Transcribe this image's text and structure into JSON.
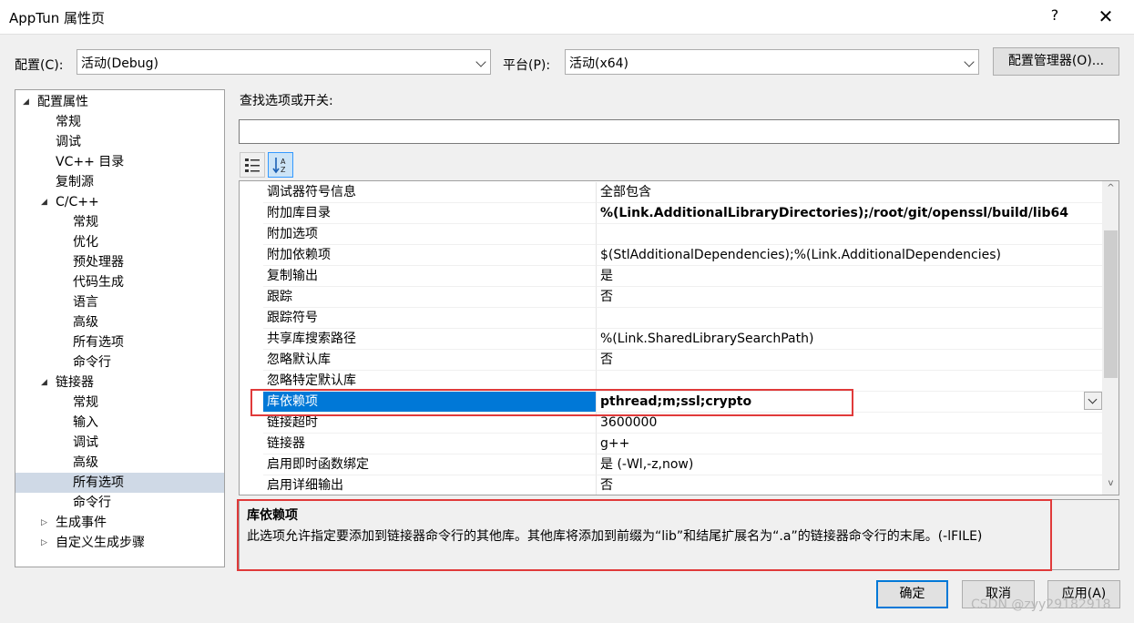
{
  "window": {
    "title": "AppTun 属性页",
    "help_glyph": "?",
    "close_glyph": "✕"
  },
  "config": {
    "label": "配置(C):",
    "value": "活动(Debug)",
    "platform_label": "平台(P):",
    "platform_value": "活动(x64)",
    "manager_button": "配置管理器(O)..."
  },
  "tree": {
    "items": [
      {
        "label": "配置属性",
        "level": 0,
        "expander": "◢"
      },
      {
        "label": "常规",
        "level": 2
      },
      {
        "label": "调试",
        "level": 2
      },
      {
        "label": "VC++ 目录",
        "level": 2
      },
      {
        "label": "复制源",
        "level": 2
      },
      {
        "label": "C/C++",
        "level": 1,
        "expander": "◢"
      },
      {
        "label": "常规",
        "level": 3
      },
      {
        "label": "优化",
        "level": 3
      },
      {
        "label": "预处理器",
        "level": 3
      },
      {
        "label": "代码生成",
        "level": 3
      },
      {
        "label": "语言",
        "level": 3
      },
      {
        "label": "高级",
        "level": 3
      },
      {
        "label": "所有选项",
        "level": 3
      },
      {
        "label": "命令行",
        "level": 3
      },
      {
        "label": "链接器",
        "level": 1,
        "expander": "◢"
      },
      {
        "label": "常规",
        "level": 3
      },
      {
        "label": "输入",
        "level": 3
      },
      {
        "label": "调试",
        "level": 3
      },
      {
        "label": "高级",
        "level": 3
      },
      {
        "label": "所有选项",
        "level": 3,
        "selected": true
      },
      {
        "label": "命令行",
        "level": 3
      },
      {
        "label": "生成事件",
        "level": 1,
        "expander": "▷"
      },
      {
        "label": "自定义生成步骤",
        "level": 1,
        "expander": "▷"
      }
    ]
  },
  "search": {
    "label": "查找选项或开关:",
    "value": ""
  },
  "toolbar": {
    "categorized_icon": "categorized-view-icon",
    "alphabetical_icon": "sort-alphabetical-icon"
  },
  "grid": {
    "rows": [
      {
        "name": "调试器符号信息",
        "value": "全部包含"
      },
      {
        "name": "附加库目录",
        "value": "%(Link.AdditionalLibraryDirectories);/root/git/openssl/build/lib64",
        "bold": true
      },
      {
        "name": "附加选项",
        "value": ""
      },
      {
        "name": "附加依赖项",
        "value": "$(StlAdditionalDependencies);%(Link.AdditionalDependencies)"
      },
      {
        "name": "复制输出",
        "value": "是"
      },
      {
        "name": "跟踪",
        "value": "否"
      },
      {
        "name": "跟踪符号",
        "value": ""
      },
      {
        "name": "共享库搜索路径",
        "value": "%(Link.SharedLibrarySearchPath)"
      },
      {
        "name": "忽略默认库",
        "value": "否"
      },
      {
        "name": "忽略特定默认库",
        "value": ""
      },
      {
        "name": "库依赖项",
        "value": "pthread;m;ssl;crypto",
        "selected": true
      },
      {
        "name": "链接超时",
        "value": "3600000"
      },
      {
        "name": "链接器",
        "value": "g++"
      },
      {
        "name": "启用即时函数绑定",
        "value": "是 (-Wl,-z,now)"
      },
      {
        "name": "启用详细输出",
        "value": "否"
      }
    ],
    "scroll_up": "^",
    "scroll_down": "v",
    "scroll_position": 0.25
  },
  "description": {
    "title": "库依赖项",
    "text": "此选项允许指定要添加到链接器命令行的其他库。其他库将添加到前缀为“lib”和结尾扩展名为“.a”的链接器命令行的末尾。(-lFILE)"
  },
  "buttons": {
    "ok": "确定",
    "cancel": "取消",
    "apply": "应用(A)"
  },
  "watermark": "CSDN @zyy29182918",
  "colors": {
    "selection": "#0078d7",
    "tree_selection": "#cfd9e6",
    "highlight_box": "#e03a3a"
  }
}
